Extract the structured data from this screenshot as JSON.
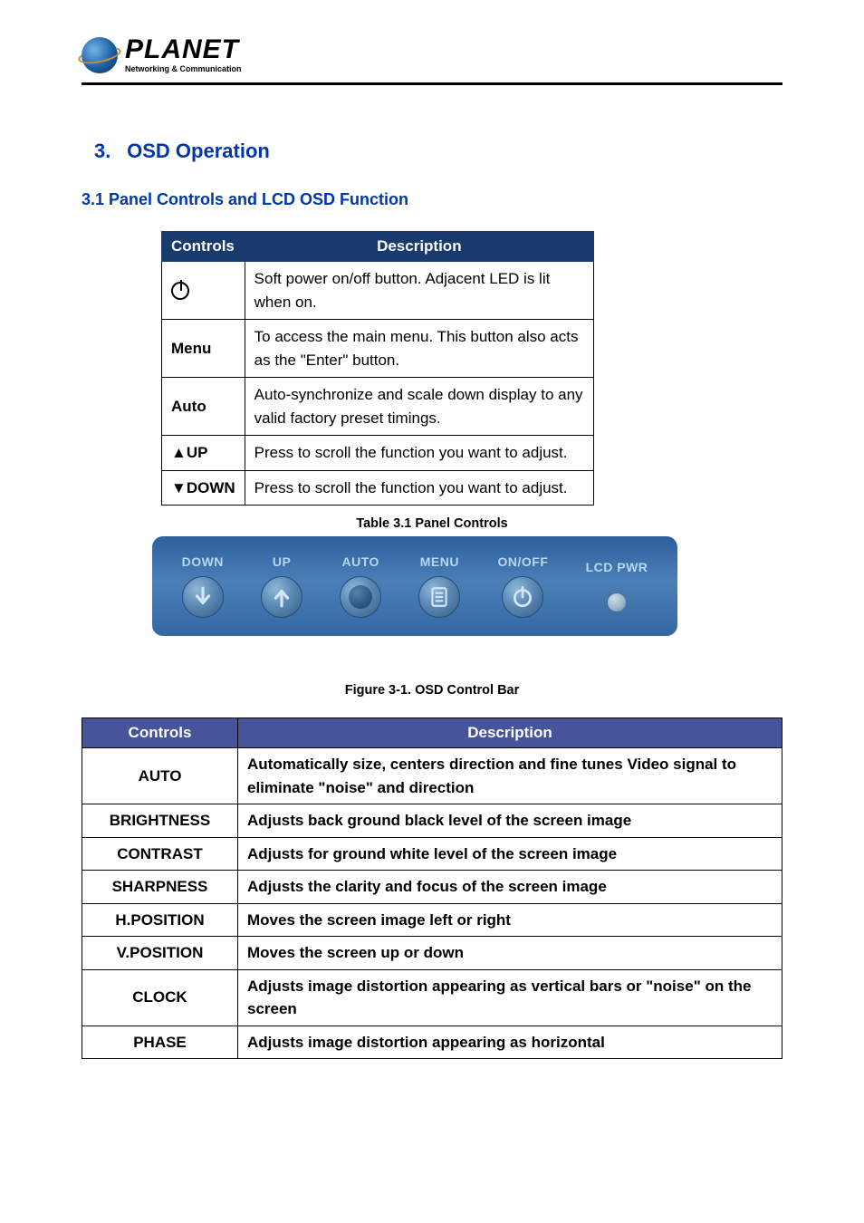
{
  "logo": {
    "name": "PLANET",
    "tagline": "Networking & Communication"
  },
  "section": {
    "number": "3.",
    "title": "OSD Operation"
  },
  "subsection": "3.1 Panel Controls and LCD OSD Function",
  "table1": {
    "headers": {
      "controls": "Controls",
      "description": "Description"
    },
    "rows": [
      {
        "control": "__POWER_ICON__",
        "description": "Soft power on/off button. Adjacent LED is lit when on."
      },
      {
        "control": "Menu",
        "description": "To access the main menu. This button also acts as the \"Enter\" button."
      },
      {
        "control": "Auto",
        "description": "Auto-synchronize and scale down display to any valid factory preset timings."
      },
      {
        "control": "▲UP",
        "description": "Press to scroll the function you want to adjust."
      },
      {
        "control": "▼DOWN",
        "description": "Press to scroll the function you want to adjust."
      }
    ],
    "caption": "Table 3.1 Panel Controls"
  },
  "controlBar": {
    "items": [
      {
        "label": "DOWN",
        "icon": "down-arrow"
      },
      {
        "label": "UP",
        "icon": "up-arrow"
      },
      {
        "label": "AUTO",
        "icon": "solid-circle"
      },
      {
        "label": "MENU",
        "icon": "menu-list"
      },
      {
        "label": "ON/OFF",
        "icon": "power"
      },
      {
        "label": "LCD PWR",
        "icon": "led"
      }
    ]
  },
  "figureCaption": "Figure 3-1. OSD Control Bar",
  "table2": {
    "headers": {
      "controls": "Controls",
      "description": "Description"
    },
    "rows": [
      {
        "control": "AUTO",
        "description": "Automatically size, centers direction and fine tunes Video signal to eliminate \"noise\" and direction"
      },
      {
        "control": "BRIGHTNESS",
        "description": "Adjusts back ground black level of the screen image"
      },
      {
        "control": "CONTRAST",
        "description": "Adjusts for ground white level of the screen image"
      },
      {
        "control": "SHARPNESS",
        "description": "Adjusts the clarity and focus of the screen image"
      },
      {
        "control": "H.POSITION",
        "description": "Moves the screen image left or right"
      },
      {
        "control": "V.POSITION",
        "description": "Moves the screen up or down"
      },
      {
        "control": "CLOCK",
        "description": "Adjusts image distortion appearing as vertical bars or \"noise\" on the screen"
      },
      {
        "control": "PHASE",
        "description": "Adjusts image distortion appearing as horizontal"
      }
    ]
  }
}
